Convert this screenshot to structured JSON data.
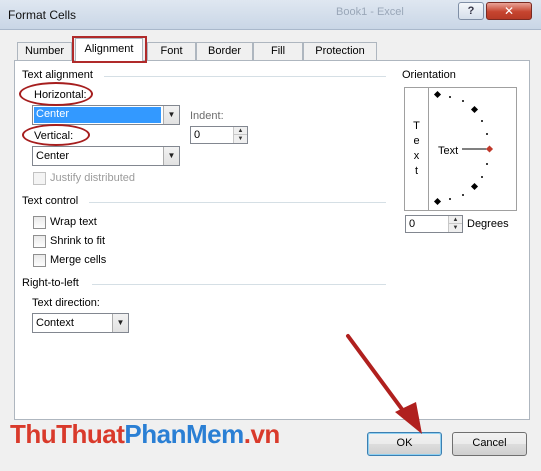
{
  "window": {
    "title": "Format Cells",
    "ghost_title": "Book1 - Excel",
    "help_glyph": "?",
    "close_glyph": "✕"
  },
  "tabs": [
    {
      "label": "Number",
      "active": false
    },
    {
      "label": "Alignment",
      "active": true
    },
    {
      "label": "Font",
      "active": false
    },
    {
      "label": "Border",
      "active": false
    },
    {
      "label": "Fill",
      "active": false
    },
    {
      "label": "Protection",
      "active": false
    }
  ],
  "text_alignment": {
    "section": "Text alignment",
    "horizontal_label": "Horizontal:",
    "horizontal_value": "Center",
    "indent_label": "Indent:",
    "indent_value": "0",
    "vertical_label": "Vertical:",
    "vertical_value": "Center",
    "justify_label": "Justify distributed"
  },
  "text_control": {
    "section": "Text control",
    "wrap": "Wrap text",
    "shrink": "Shrink to fit",
    "merge": "Merge cells"
  },
  "rtl": {
    "section": "Right-to-left",
    "direction_label": "Text direction:",
    "direction_value": "Context"
  },
  "orientation": {
    "section": "Orientation",
    "vertical_letters": [
      "T",
      "e",
      "x",
      "t"
    ],
    "dial_label": "Text",
    "degrees_value": "0",
    "degrees_label": "Degrees"
  },
  "buttons": {
    "ok": "OK",
    "cancel": "Cancel"
  },
  "watermark": {
    "part1": "ThuThuat",
    "part2": "PhanMem",
    "part3": ".vn"
  },
  "colors": {
    "annotation": "#a61e1e",
    "selection": "#3399ff"
  }
}
